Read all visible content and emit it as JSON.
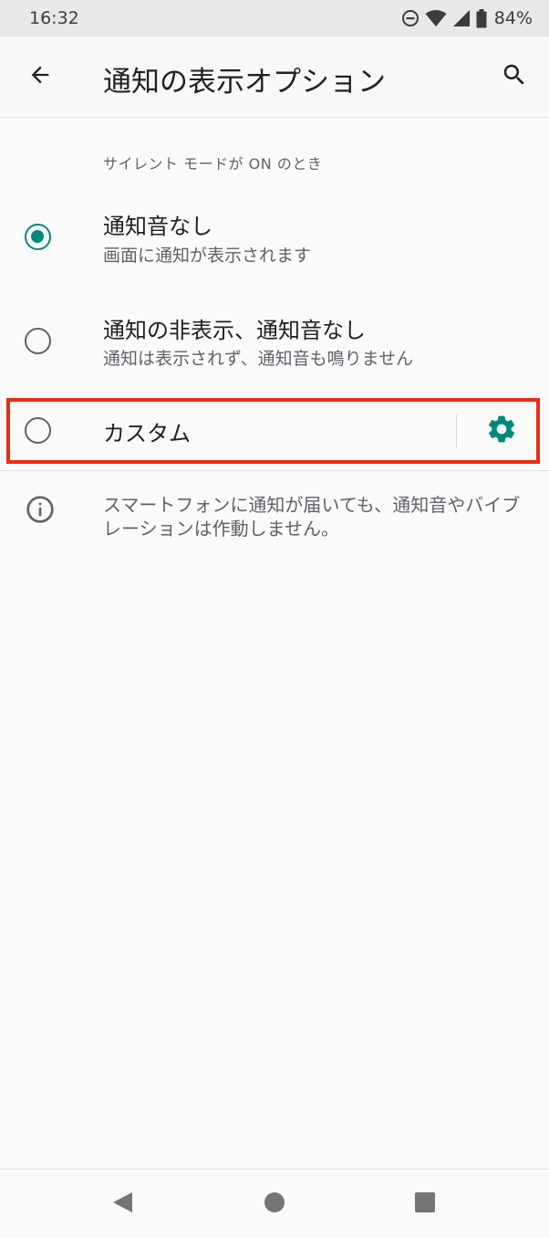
{
  "status_bar": {
    "time": "16:32",
    "battery": "84%",
    "icons": [
      "do-not-disturb-icon",
      "wifi-icon",
      "signal-icon",
      "battery-icon"
    ]
  },
  "app_bar": {
    "title": "通知の表示オプション",
    "back_icon": "arrow-back-icon",
    "search_icon": "search-icon"
  },
  "section": {
    "header": "サイレント モードが ON のとき"
  },
  "options": [
    {
      "title": "通知音なし",
      "subtitle": "画面に通知が表示されます",
      "selected": true
    },
    {
      "title": "通知の非表示、通知音なし",
      "subtitle": "通知は表示されず、通知音も鳴りません",
      "selected": false
    },
    {
      "title": "カスタム",
      "selected": false,
      "settings_icon": "gear-icon"
    }
  ],
  "info": {
    "icon": "info-icon",
    "text": "スマートフォンに通知が届いても、通知音やバイブレーションは作動しません。"
  },
  "nav_bar": {
    "back_icon": "nav-back-icon",
    "home_icon": "nav-home-icon",
    "recents_icon": "nav-recents-icon"
  },
  "colors": {
    "accent": "#00897b",
    "highlight": "#ee2b14",
    "text_primary": "#202124",
    "text_secondary": "#5f6368",
    "background": "#fafafa"
  }
}
